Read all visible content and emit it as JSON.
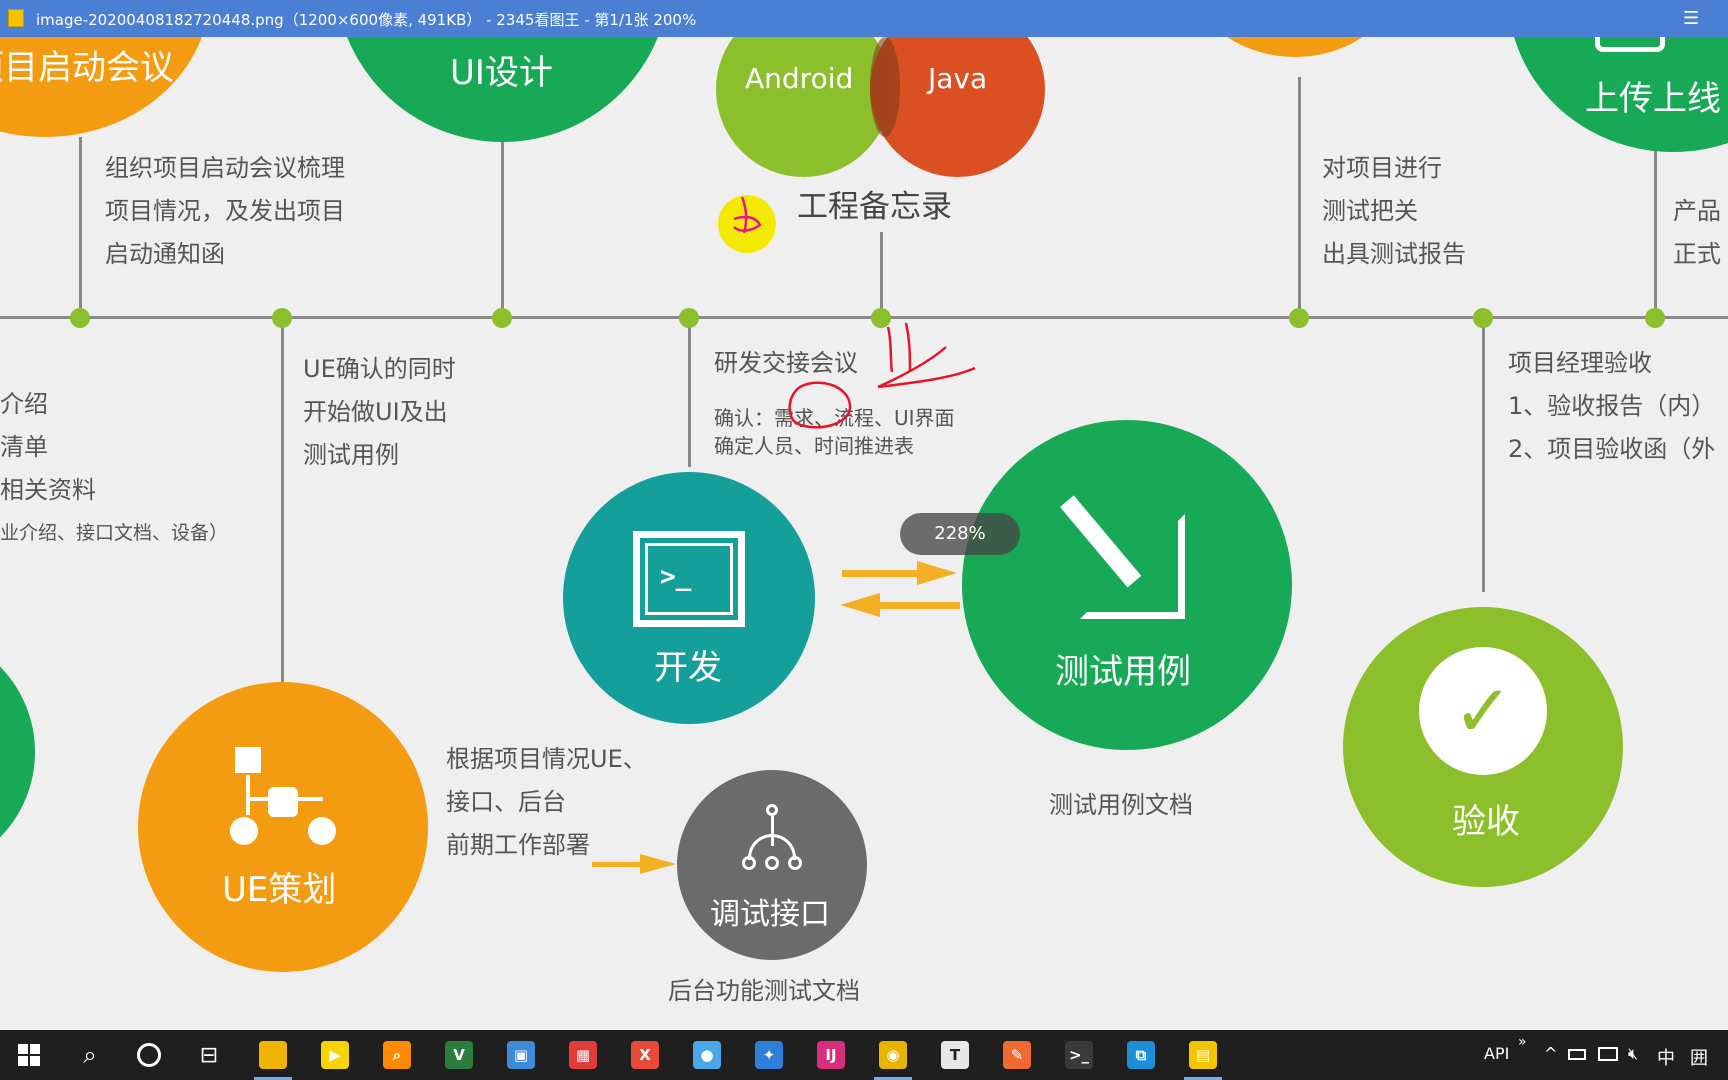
{
  "titlebar": {
    "title": "image-20200408182720448.png（1200×600像素, 491KB） - 2345看图王 - 第1/1张 200%",
    "menu_glyph": "☰"
  },
  "diagram": {
    "top": {
      "kickoff_label": "项目启动会议",
      "kickoff_desc": [
        "组织项目启动会议梳理",
        "项目情况，及发出项目",
        "启动通知函"
      ],
      "ui_design_label": "UI设计",
      "android_label": "Android",
      "java_label": "Java",
      "memo_label": "工程备忘录",
      "testing_desc": [
        "对项目进行",
        "测试把关",
        "出具测试报告"
      ],
      "upload_label": "上传上线",
      "upload_desc": [
        "产品",
        "正式"
      ]
    },
    "bottom": {
      "left_desc": [
        "介绍",
        "清单",
        "相关资料",
        "业介绍、接口文档、设备）"
      ],
      "ue_confirm_desc": [
        "UE确认的同时",
        "开始做UI及出",
        "测试用例"
      ],
      "dev_meeting_title": "研发交接会议",
      "dev_meeting_desc": [
        "确认：需求、流程、UI界面",
        "确定人员、时间推进表"
      ],
      "acceptance_desc": [
        "项目经理验收",
        "1、验收报告（内）",
        "2、项目验收函（外"
      ],
      "dev_label": "开发",
      "testcase_label": "测试用例",
      "testcase_caption": "测试用例文档",
      "acceptance_label": "验收",
      "ue_label": "UE策划",
      "ue_desc": [
        "根据项目情况UE、",
        "接口、后台",
        "前期工作部署"
      ],
      "api_debug_label": "调试接口",
      "api_debug_caption": "后台功能测试文档"
    },
    "zoom_indicator": "228%"
  },
  "taskbar": {
    "apps": [
      {
        "name": "file-explorer-app",
        "icon": "folder-icon",
        "glyph": "",
        "color": "#f0b400",
        "active": true
      },
      {
        "name": "player-app",
        "icon": "player-icon",
        "glyph": "▶",
        "color": "#f7d300",
        "active": false
      },
      {
        "name": "search-tool-app",
        "icon": "magnifier-icon",
        "glyph": "⌕",
        "color": "#ff8a00",
        "active": false
      },
      {
        "name": "vnc-app",
        "icon": "vnc-icon",
        "glyph": "V",
        "color": "#2a7d3c",
        "active": false
      },
      {
        "name": "remote-desktop-app",
        "icon": "remote-desktop-icon",
        "glyph": "▣",
        "color": "#3f8ad8",
        "active": false
      },
      {
        "name": "windows-app",
        "icon": "tiles-icon",
        "glyph": "▦",
        "color": "#e23b3b",
        "active": false
      },
      {
        "name": "xmind-app",
        "icon": "xmind-icon",
        "glyph": "X",
        "color": "#e84a3a",
        "active": false
      },
      {
        "name": "feiq-app",
        "icon": "chat-icon",
        "glyph": "●",
        "color": "#4aa8e8",
        "active": false
      },
      {
        "name": "dolphin-app",
        "icon": "dolphin-icon",
        "glyph": "✦",
        "color": "#2f7fd8",
        "active": false
      },
      {
        "name": "intellij-app",
        "icon": "ide-icon",
        "glyph": "IJ",
        "color": "#d62e7a",
        "active": false
      },
      {
        "name": "chrome-app",
        "icon": "chrome-icon",
        "glyph": "◉",
        "color": "#e8b400",
        "active": true
      },
      {
        "name": "typora-app",
        "icon": "typora-icon",
        "glyph": "T",
        "color": "#e8e8e8",
        "active": false
      },
      {
        "name": "postman-app",
        "icon": "postman-icon",
        "glyph": "✎",
        "color": "#ef6a30",
        "active": false
      },
      {
        "name": "terminal-app",
        "icon": "terminal-icon",
        "glyph": ">_",
        "color": "#3a3a3a",
        "active": false
      },
      {
        "name": "vm-app",
        "icon": "vm-icon",
        "glyph": "⧉",
        "color": "#1c8fd6",
        "active": false
      },
      {
        "name": "image-viewer-app",
        "icon": "image-viewer-icon",
        "glyph": "▤",
        "color": "#f5c400",
        "active": true
      }
    ],
    "tray": {
      "api_label": "API",
      "chevron_glyph": "»",
      "caret_glyph": "^",
      "ime_label": "中",
      "keyboard_glyph": "囲"
    }
  },
  "colors": {
    "orange": "#f39c12",
    "green": "#18a957",
    "lime": "#8cbf2c",
    "teal": "#149f9a",
    "gray": "#6b6b6b",
    "red": "#d94a1b",
    "arrow": "#f2b022",
    "annotation": "#e8142a"
  }
}
